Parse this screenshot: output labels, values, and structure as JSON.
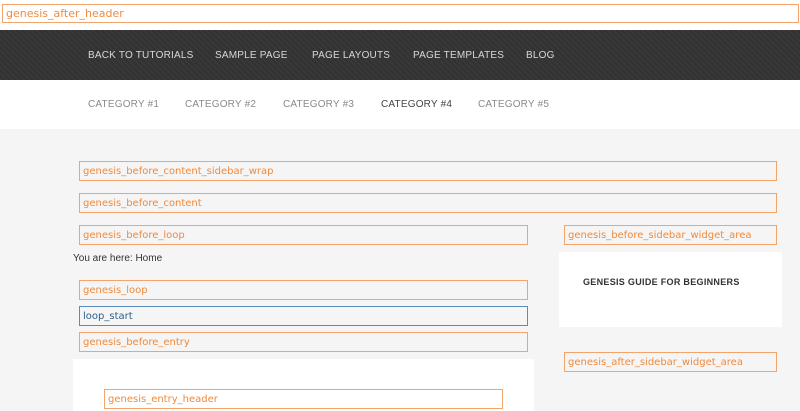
{
  "hooks": {
    "after_header": "genesis_after_header",
    "before_content_sidebar_wrap": "genesis_before_content_sidebar_wrap",
    "before_content": "genesis_before_content",
    "before_loop": "genesis_before_loop",
    "before_sidebar_widget_area": "genesis_before_sidebar_widget_area",
    "loop": "genesis_loop",
    "loop_start": "loop_start",
    "before_entry": "genesis_before_entry",
    "after_sidebar_widget_area": "genesis_after_sidebar_widget_area",
    "entry_header": "genesis_entry_header"
  },
  "primary_nav": {
    "items": [
      {
        "label": "BACK TO TUTORIALS"
      },
      {
        "label": "SAMPLE PAGE"
      },
      {
        "label": "PAGE LAYOUTS"
      },
      {
        "label": "PAGE TEMPLATES"
      },
      {
        "label": "BLOG"
      }
    ]
  },
  "secondary_nav": {
    "items": [
      {
        "label": "CATEGORY #1"
      },
      {
        "label": "CATEGORY #2"
      },
      {
        "label": "CATEGORY #3"
      },
      {
        "label": "CATEGORY #4",
        "active": true
      },
      {
        "label": "CATEGORY #5"
      }
    ]
  },
  "breadcrumb": "You are here: Home",
  "sidebar": {
    "widget_title": "GENESIS GUIDE FOR BEGINNERS"
  },
  "colors": {
    "hook_border": "#f2a46a",
    "hook_text": "#f08a3c",
    "loop_start_border": "#5b8db8",
    "nav_bg": "#333333",
    "page_bg": "#f5f5f5"
  }
}
